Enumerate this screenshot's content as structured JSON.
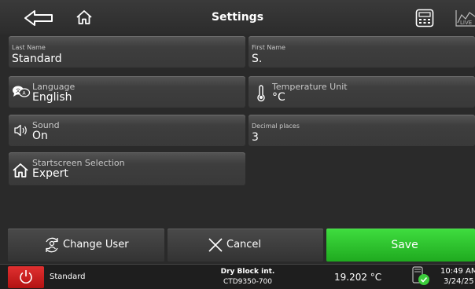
{
  "header": {
    "title": "Settings"
  },
  "fields": {
    "last_name": {
      "label": "Last Name",
      "value": "Standard"
    },
    "first_name": {
      "label": "First Name",
      "value": "S."
    },
    "language": {
      "label": "Language",
      "value": "English"
    },
    "temperature_unit": {
      "label": "Temperature Unit",
      "value": "°C"
    },
    "sound": {
      "label": "Sound",
      "value": "On"
    },
    "decimal_places": {
      "label": "Decimal places",
      "value": "3"
    },
    "startscreen": {
      "label": "Startscreen Selection",
      "value": "Expert"
    }
  },
  "actions": {
    "change_user": "Change User",
    "cancel": "Cancel",
    "save": "Save"
  },
  "status": {
    "user": "Standard",
    "device_name": "Dry Block int.",
    "device_id": "CTD9350-700",
    "temperature": "19.202 °C",
    "time": "10:49 AM",
    "date": "3/24/25"
  },
  "icons": {
    "back": "back-arrow-icon",
    "home": "home-icon",
    "calculator": "calculator-icon",
    "live": "live-chart-icon",
    "language": "language-chat-icon",
    "temperature": "thermometer-icon",
    "sound": "speaker-icon",
    "startscreen": "home-icon",
    "change_user": "change-user-icon",
    "cancel": "close-icon",
    "power": "power-icon",
    "device": "device-status-icon"
  },
  "colors": {
    "background": "#2a2a2a",
    "tile": "#3e3e3e",
    "save": "#2cc52c",
    "power": "#c81a1a",
    "status_ok": "#3ccd3c"
  }
}
